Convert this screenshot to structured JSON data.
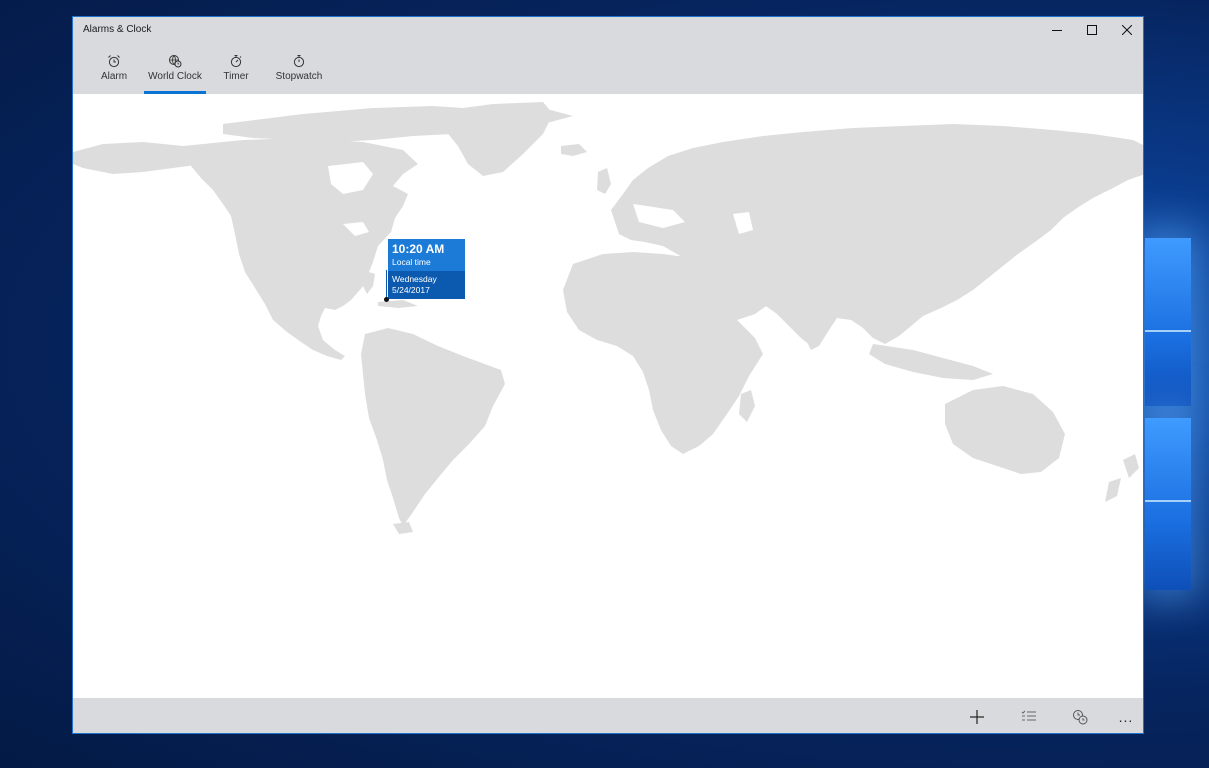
{
  "window": {
    "title": "Alarms & Clock"
  },
  "tabs": [
    {
      "label": "Alarm",
      "icon": "alarm-clock-icon"
    },
    {
      "label": "World Clock",
      "icon": "globe-clock-icon",
      "active": true
    },
    {
      "label": "Timer",
      "icon": "timer-icon"
    },
    {
      "label": "Stopwatch",
      "icon": "stopwatch-icon"
    }
  ],
  "tooltip": {
    "time": "10:20 AM",
    "label": "Local time",
    "day": "Wednesday",
    "date": "5/24/2017"
  },
  "commands": [
    {
      "icon": "plus-icon"
    },
    {
      "icon": "select-list-icon"
    },
    {
      "icon": "compare-clocks-icon"
    },
    {
      "icon": "more-icon",
      "label": "..."
    }
  ],
  "colors": {
    "accent": "#0a74d4",
    "tooltip_top": "#1d7bd8",
    "tooltip_bottom": "#0b5aaf",
    "map_land": "#dddddd",
    "chrome": "#d8dadd"
  }
}
